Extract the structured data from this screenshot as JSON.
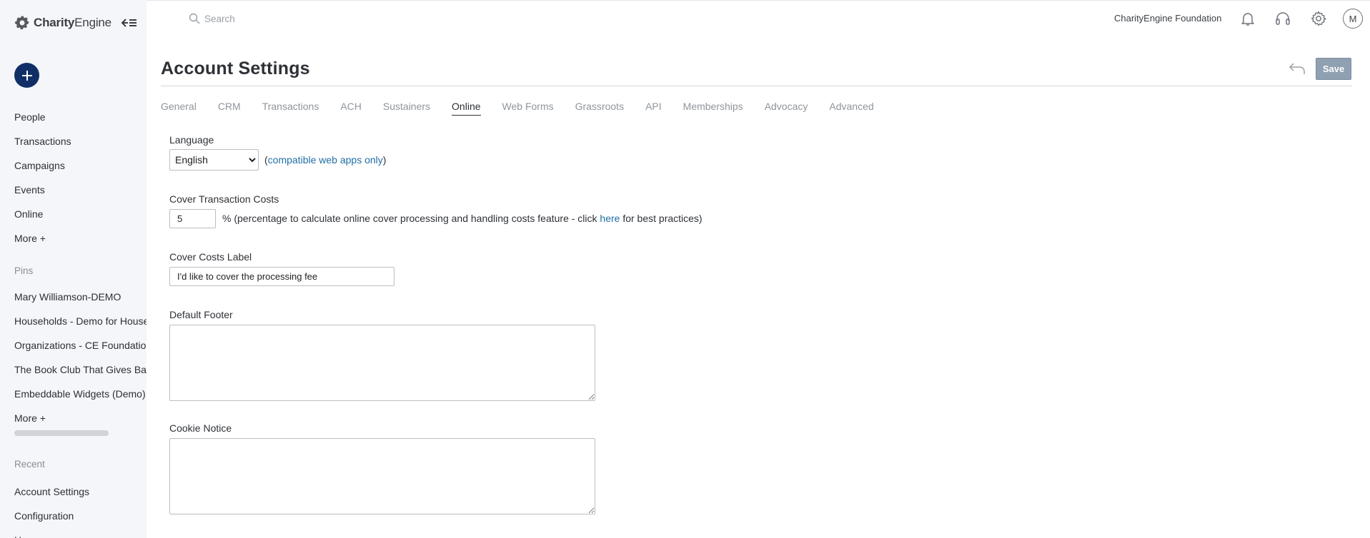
{
  "app": {
    "logo_text_bold": "Charity",
    "logo_text_light": "Engine",
    "organization": "CharityEngine Foundation",
    "user_initial": "M"
  },
  "search": {
    "placeholder": "Search"
  },
  "sidebar": {
    "nav": [
      "People",
      "Transactions",
      "Campaigns",
      "Events",
      "Online",
      "More +"
    ],
    "pins_label": "Pins",
    "pins": [
      "Mary Williamson-DEMO",
      "Households - Demo for Households",
      "Organizations - CE Foundation",
      "The Book Club That Gives Back",
      "Embeddable Widgets (Demo)",
      "More +"
    ],
    "recent_label": "Recent",
    "recent": [
      "Account Settings",
      "Configuration",
      "Home"
    ]
  },
  "page": {
    "title": "Account Settings",
    "save_label": "Save"
  },
  "tabs": [
    "General",
    "CRM",
    "Transactions",
    "ACH",
    "Sustainers",
    "Online",
    "Web Forms",
    "Grassroots",
    "API",
    "Memberships",
    "Advocacy",
    "Advanced"
  ],
  "active_tab": "Online",
  "form": {
    "language": {
      "label": "Language",
      "selected": "English",
      "note_prefix": "(",
      "note_link": "compatible web apps only",
      "note_suffix": ")"
    },
    "cover_costs": {
      "label": "Cover Transaction Costs",
      "value": "5",
      "note_before": "% (percentage to calculate online cover processing and handling costs feature - click ",
      "note_link": "here",
      "note_after": " for best practices)"
    },
    "cover_label": {
      "label": "Cover Costs Label",
      "value": "I'd like to cover the processing fee"
    },
    "default_footer": {
      "label": "Default Footer",
      "value": ""
    },
    "cookie_notice": {
      "label": "Cookie Notice",
      "value": ""
    }
  },
  "colors": {
    "sidebar_bg": "#f4f6f9",
    "brand_navy": "#0f2f66",
    "link": "#1f6ea4",
    "save_button": "#8ea0b1"
  },
  "icons": {
    "logo": "gear-logo-icon",
    "collapse": "collapse-sidebar-icon",
    "add": "plus-icon",
    "search": "search-icon",
    "notifications": "bell-icon",
    "support": "headset-icon",
    "settings": "gear-icon",
    "undo": "undo-arrow-icon"
  }
}
